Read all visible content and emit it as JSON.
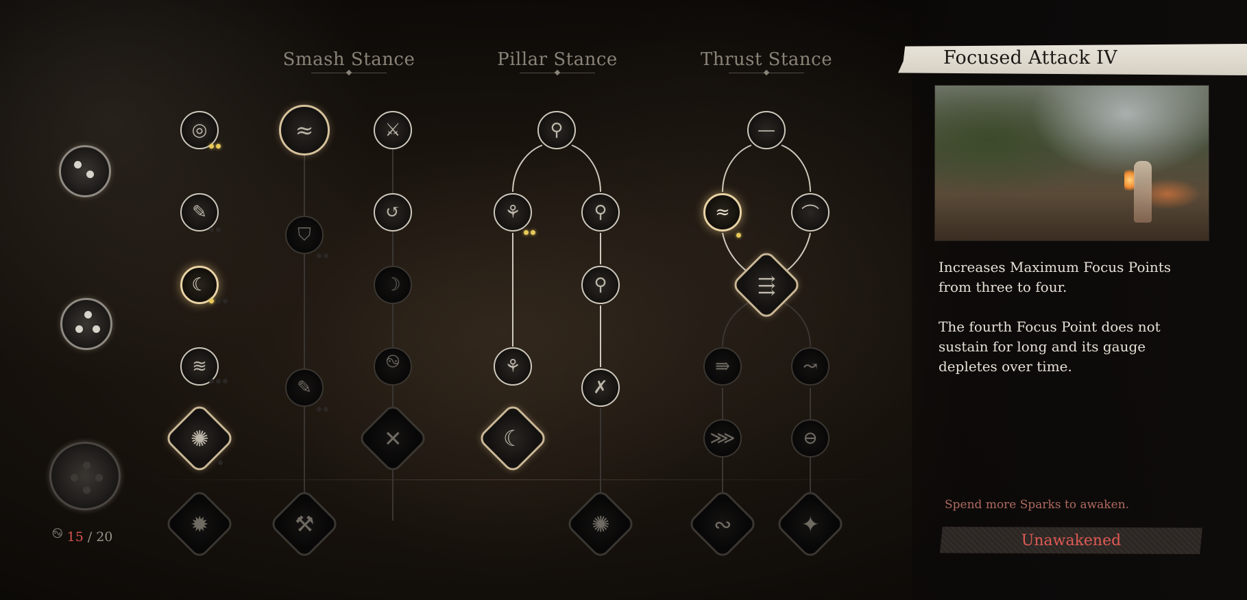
{
  "stances": [
    {
      "id": "smash",
      "title": "Smash Stance"
    },
    {
      "id": "pillar",
      "title": "Pillar Stance"
    },
    {
      "id": "thrust",
      "title": "Thrust Stance"
    }
  ],
  "focus_points": {
    "sparks_current": "15",
    "sparks_separator": "/",
    "sparks_max": "20",
    "spark_icon": "spiral-spark-icon"
  },
  "detail": {
    "title": "Focused Attack IV",
    "preview_image": "skill-preview-image",
    "description": [
      "Increases Maximum Focus Points from three to four.",
      "The fourth Focus Point does not sustain for long and its gauge depletes over time."
    ],
    "hint": "Spend more Sparks to awaken.",
    "status_button": "Unawakened"
  },
  "colors": {
    "accent_gold": "#e8d3a5",
    "focus_dot": "#e7c95a",
    "warning_red": "#e05a55",
    "banner": "#e9e4da"
  },
  "nodes": [
    {
      "id": "core-1",
      "icon": "focus-orb-icon",
      "state": "unlocked",
      "dots": [
        1,
        1
      ]
    },
    {
      "id": "core-2",
      "icon": "staff-swing-icon",
      "state": "unlocked",
      "dots": [
        0,
        0
      ]
    },
    {
      "id": "core-3",
      "icon": "crescent-strike-icon",
      "state": "active",
      "dots": [
        1,
        0,
        0
      ]
    },
    {
      "id": "core-4",
      "icon": "whirl-slash-icon",
      "state": "unlocked",
      "dots": [
        0,
        0,
        0
      ]
    },
    {
      "id": "core-5",
      "icon": "spin-staff-icon",
      "state": "unlocked",
      "dots": [
        0
      ]
    },
    {
      "id": "core-6",
      "icon": "heavy-spin-icon",
      "state": "locked",
      "dots": []
    },
    {
      "id": "smash-a1",
      "icon": "wind-strike-icon",
      "state": "unlocked",
      "dots": []
    },
    {
      "id": "smash-a2",
      "icon": "guard-break-icon",
      "state": "locked",
      "dots": [
        0,
        0
      ]
    },
    {
      "id": "smash-a3",
      "icon": "staff-charge-icon",
      "state": "locked",
      "dots": [
        0,
        0
      ]
    },
    {
      "id": "smash-a4",
      "icon": "smash-finisher-icon",
      "state": "locked",
      "dots": []
    },
    {
      "id": "smash-b1",
      "icon": "staff-plant-icon",
      "state": "unlocked",
      "dots": []
    },
    {
      "id": "smash-b2",
      "icon": "swirl-guard-icon",
      "state": "unlocked",
      "dots": []
    },
    {
      "id": "smash-b3",
      "icon": "crescent-moon-icon",
      "state": "locked",
      "dots": []
    },
    {
      "id": "smash-b4",
      "icon": "whirlwind-icon",
      "state": "locked",
      "dots": []
    },
    {
      "id": "smash-b5",
      "icon": "crossed-staff-icon",
      "state": "locked",
      "dots": []
    },
    {
      "id": "pillar-1",
      "icon": "pillar-rise-icon",
      "state": "unlocked",
      "dots": []
    },
    {
      "id": "pillar-l1",
      "icon": "pillar-root-icon",
      "state": "unlocked",
      "dots": [
        1,
        1
      ]
    },
    {
      "id": "pillar-l2",
      "icon": "pillar-leaf-icon",
      "state": "unlocked",
      "dots": []
    },
    {
      "id": "pillar-l3",
      "icon": "pillar-sweep-icon",
      "state": "unlocked",
      "dots": []
    },
    {
      "id": "pillar-r1",
      "icon": "pillar-ring-icon",
      "state": "unlocked",
      "dots": []
    },
    {
      "id": "pillar-r2",
      "icon": "pillar-spin-icon",
      "state": "unlocked",
      "dots": []
    },
    {
      "id": "pillar-r3",
      "icon": "pillar-cross-icon",
      "state": "unlocked",
      "dots": []
    },
    {
      "id": "pillar-r4",
      "icon": "pillar-burst-icon",
      "state": "locked",
      "dots": []
    },
    {
      "id": "thrust-1",
      "icon": "thrust-line-icon",
      "state": "unlocked",
      "dots": []
    },
    {
      "id": "thrust-l1",
      "icon": "thrust-wind-icon",
      "state": "active",
      "dots": [
        1
      ]
    },
    {
      "id": "thrust-r1",
      "icon": "thrust-arc-icon",
      "state": "unlocked",
      "dots": []
    },
    {
      "id": "thrust-mid",
      "icon": "thrust-rush-icon",
      "state": "unlocked",
      "dots": []
    },
    {
      "id": "thrust-l2",
      "icon": "thrust-dash-icon",
      "state": "locked",
      "dots": []
    },
    {
      "id": "thrust-r2",
      "icon": "thrust-whip-icon",
      "state": "locked",
      "dots": []
    },
    {
      "id": "thrust-l3",
      "icon": "thrust-feather-icon",
      "state": "locked",
      "dots": []
    },
    {
      "id": "thrust-r3",
      "icon": "thrust-eye-icon",
      "state": "locked",
      "dots": []
    },
    {
      "id": "thrust-l4",
      "icon": "thrust-wave-icon",
      "state": "locked",
      "dots": []
    },
    {
      "id": "thrust-r4",
      "icon": "thrust-star-icon",
      "state": "locked",
      "dots": []
    }
  ]
}
